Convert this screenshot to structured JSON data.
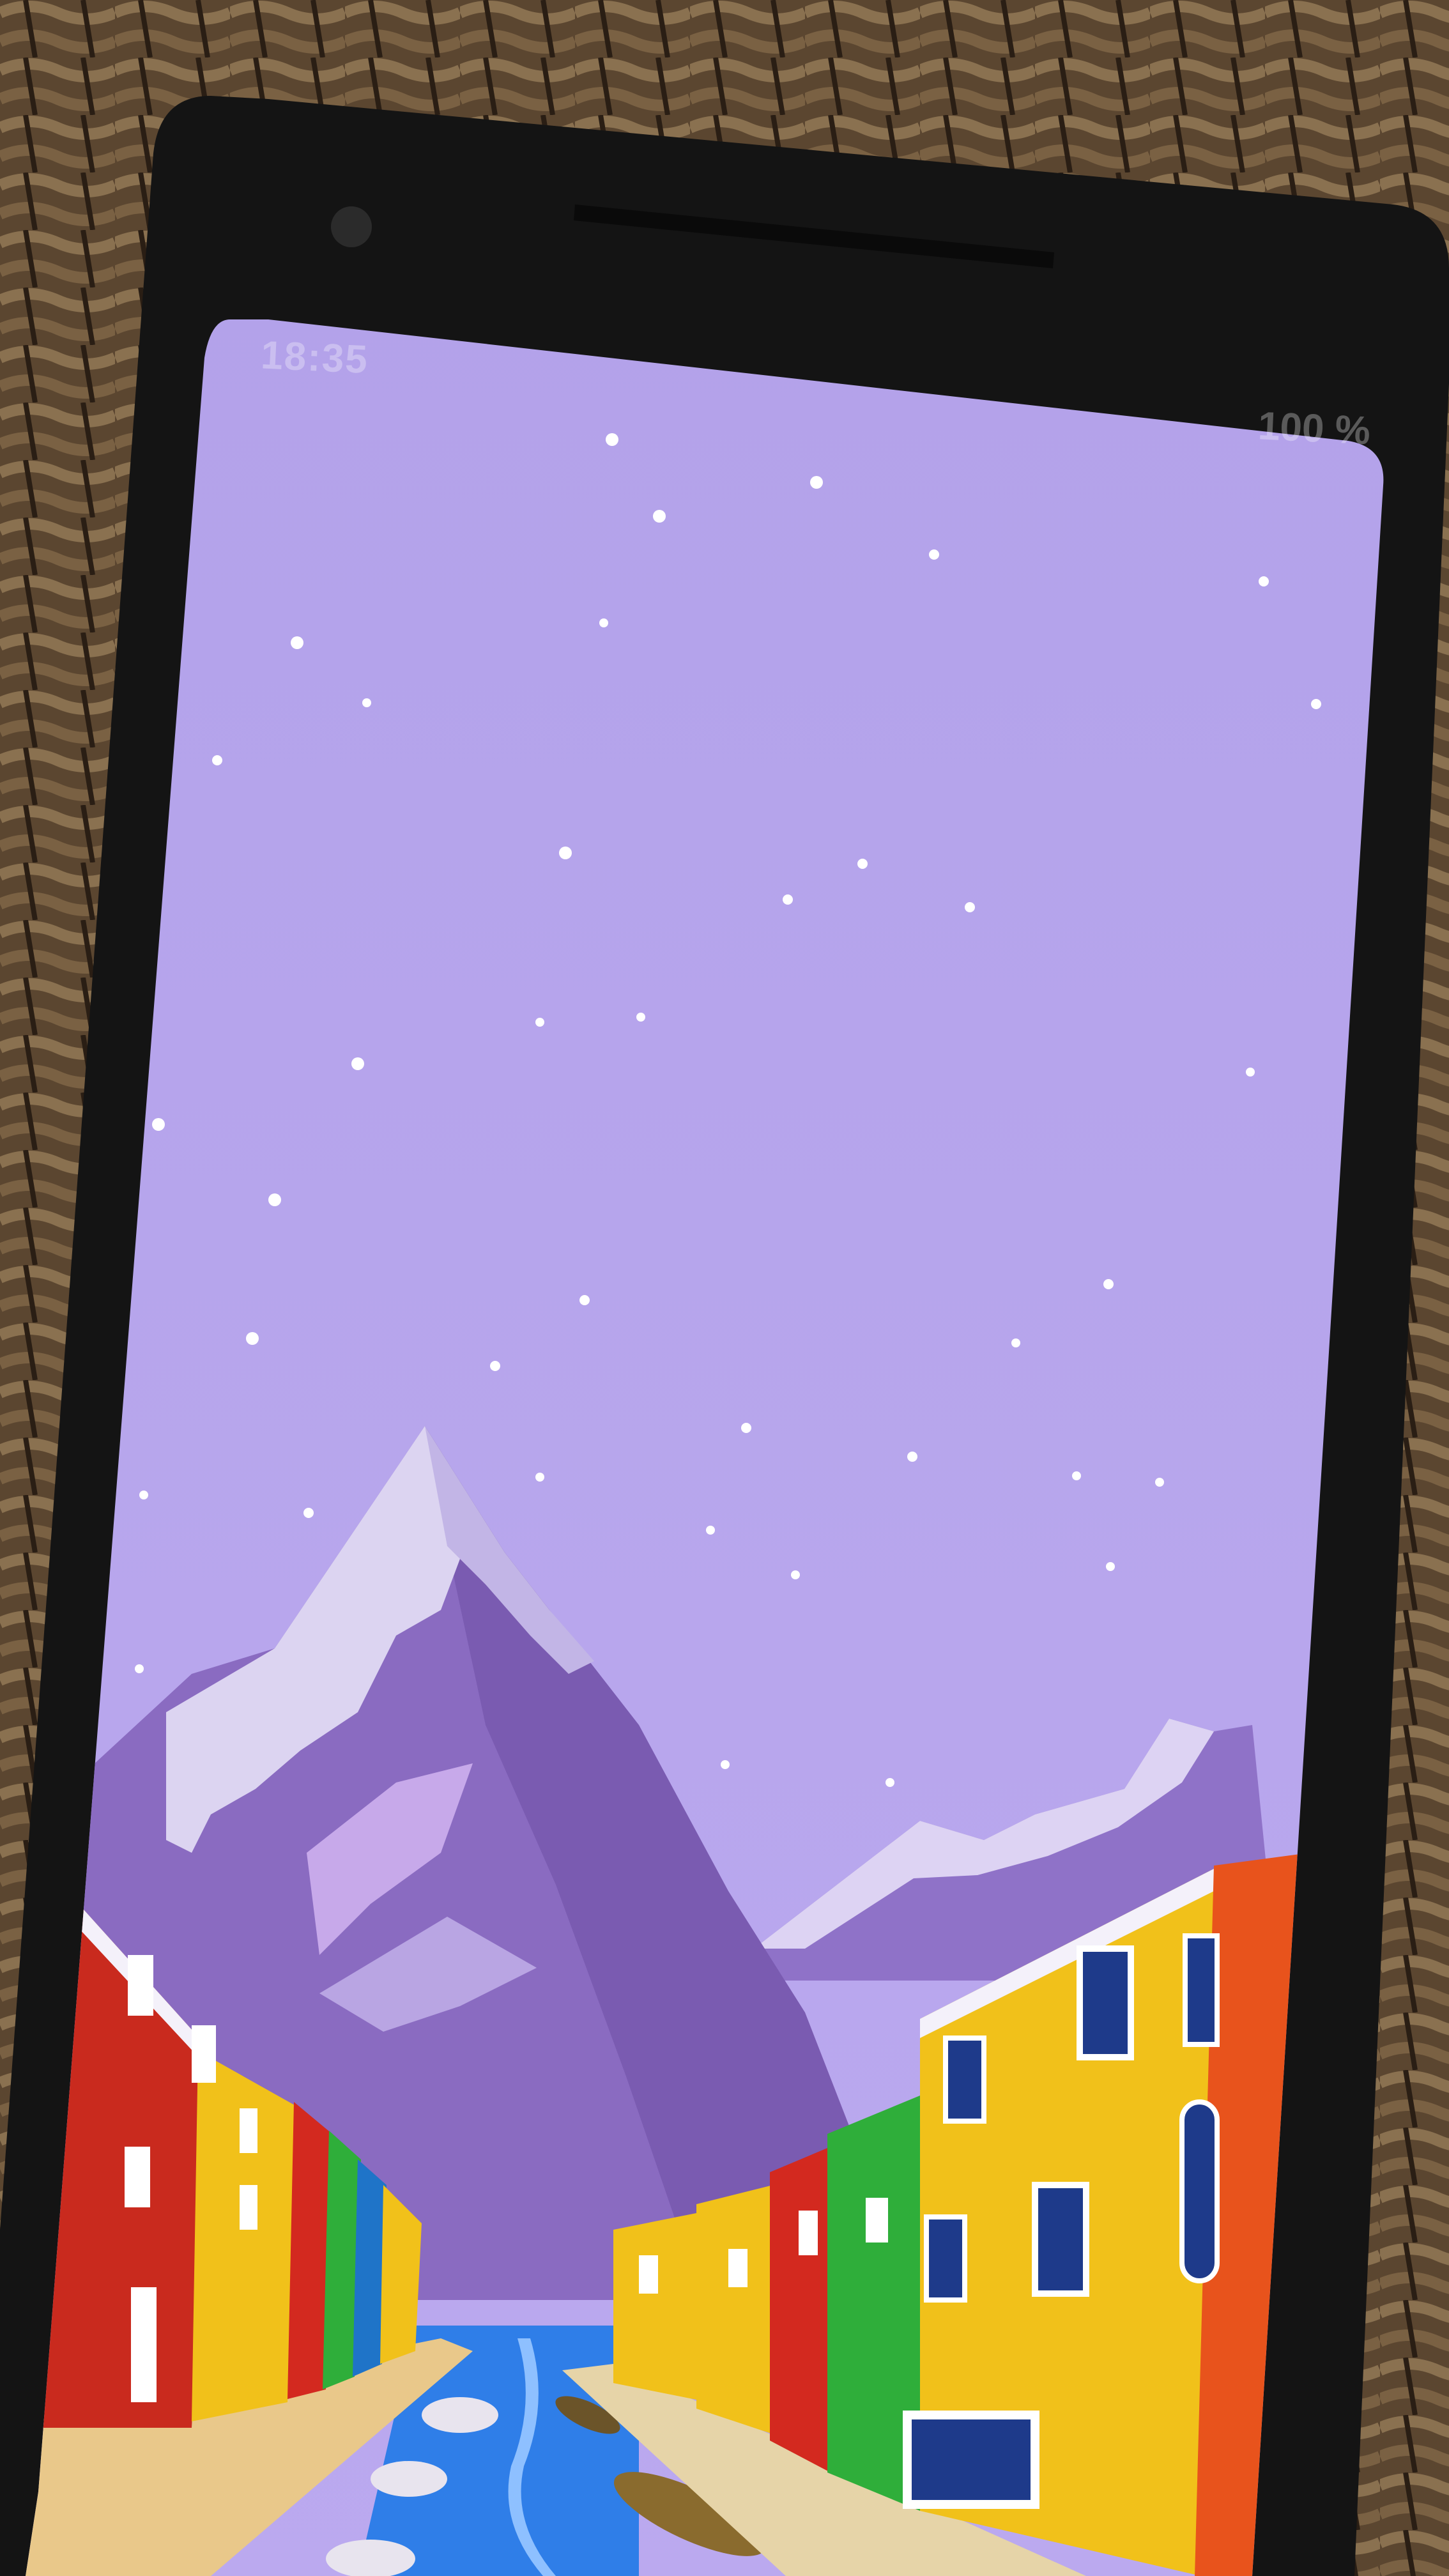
{
  "photo": {
    "subject": "smartphone-on-woven-mat",
    "mat_color": "#5b4630",
    "phone_body_color": "#141414"
  },
  "status_bar": {
    "time": "18:35",
    "battery": "100 %"
  },
  "wallpaper": {
    "sky_color": "#b8a6ee",
    "mountain_color": "#8b6cc0",
    "snow_color": "#ddd6f2",
    "canal_color": "#2f7ee8",
    "building_colors": [
      "#c92a1e",
      "#f1c11a",
      "#2fae3a",
      "#1f74c8",
      "#e8531c"
    ]
  }
}
